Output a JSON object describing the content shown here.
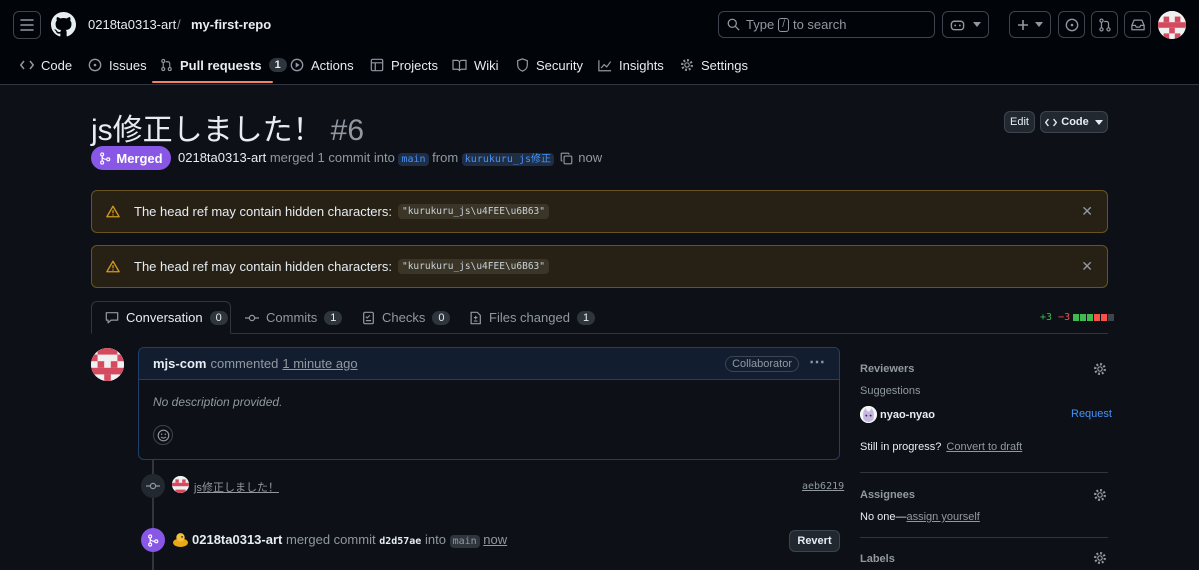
{
  "header": {
    "owner": "0218ta0313-art",
    "separator": "/",
    "repo": "my-first-repo",
    "search": {
      "prefix": "Type",
      "key": "/",
      "suffix": "to search"
    }
  },
  "repo_nav": [
    {
      "label": "Code",
      "icon": "code-icon"
    },
    {
      "label": "Issues",
      "icon": "issue-icon"
    },
    {
      "label": "Pull requests",
      "icon": "pull-request-icon",
      "count": "1",
      "selected": true
    },
    {
      "label": "Actions",
      "icon": "play-icon"
    },
    {
      "label": "Projects",
      "icon": "table-icon"
    },
    {
      "label": "Wiki",
      "icon": "book-icon"
    },
    {
      "label": "Security",
      "icon": "shield-icon"
    },
    {
      "label": "Insights",
      "icon": "graph-icon"
    },
    {
      "label": "Settings",
      "icon": "gear-icon"
    }
  ],
  "pr": {
    "title": "js修正しました！",
    "number": "#6",
    "edit_label": "Edit",
    "code_label": "Code",
    "state": "Merged",
    "author": "0218ta0313-art",
    "merged_text": "merged 1 commit into",
    "base_branch": "main",
    "from_text": "from",
    "head_branch": "kurukuru_js修正",
    "time": "now"
  },
  "warnings": [
    {
      "text": "The head ref may contain hidden characters:",
      "code": "\"kurukuru_js\\u4FEE\\u6B63\""
    },
    {
      "text": "The head ref may contain hidden characters:",
      "code": "\"kurukuru_js\\u4FEE\\u6B63\""
    }
  ],
  "tabs": [
    {
      "label": "Conversation",
      "count": "0",
      "icon": "comment-icon"
    },
    {
      "label": "Commits",
      "count": "1",
      "icon": "commit-icon"
    },
    {
      "label": "Checks",
      "count": "0",
      "icon": "checklist-icon"
    },
    {
      "label": "Files changed",
      "count": "1",
      "icon": "file-diff-icon"
    }
  ],
  "diffstat": {
    "additions": "+3",
    "deletions": "−3",
    "colors": {
      "add": "#3fb950",
      "del": "#f85149",
      "neutral": "#3d444d"
    }
  },
  "comment": {
    "author": "mjs-com",
    "action": "commented",
    "time": "1 minute ago",
    "role": "Collaborator",
    "body": "No description provided."
  },
  "timeline": {
    "commit_message": "js修正しました！",
    "commit_sha": "aeb6219",
    "merge_author": "0218ta0313-art",
    "merge_text": "merged commit",
    "merge_sha": "d2d57ae",
    "into_text": "into",
    "merge_branch": "main",
    "merge_time": "now",
    "revert_label": "Revert"
  },
  "sidebar": {
    "reviewers_title": "Reviewers",
    "suggestions_label": "Suggestions",
    "suggested_user": "nyao-nyao",
    "request_label": "Request",
    "still_in_progress": "Still in progress?",
    "convert_to_draft": "Convert to draft",
    "assignees_title": "Assignees",
    "no_one": "No one—",
    "assign_yourself": "assign yourself",
    "labels_title": "Labels"
  },
  "colors": {
    "bg": "#0d1117",
    "header_bg": "#010409",
    "merged": "#8957e5",
    "link": "#4493f8",
    "warn_bg": "#272115",
    "nav_underline": "#f78166"
  }
}
